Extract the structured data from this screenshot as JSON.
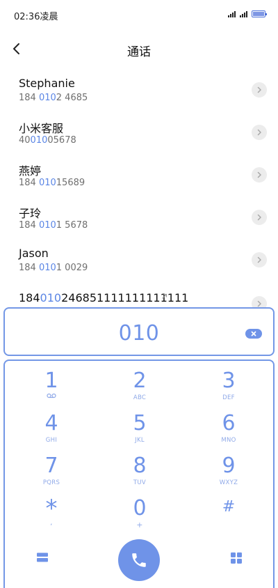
{
  "status_bar": {
    "time": "02:36凌晨"
  },
  "header": {
    "title": "通话"
  },
  "contacts": [
    {
      "name": "Stephanie",
      "number_pre": "184 ",
      "number_match": "010",
      "number_post": "2 4685"
    },
    {
      "name": "小米客服",
      "number_pre": "40",
      "number_match": "010",
      "number_post": "05678"
    },
    {
      "name": "燕婷",
      "number_pre": "184 ",
      "number_match": "010",
      "number_post": "15689"
    },
    {
      "name": "子玲",
      "number_pre": "184 ",
      "number_match": "010",
      "number_post": "1 5678"
    },
    {
      "name": "Jason",
      "number_pre": "184 ",
      "number_match": "010",
      "number_post": "1 0029"
    }
  ],
  "recent_number": {
    "pre": "184",
    "match": "010",
    "post": "246851111111111111"
  },
  "dialer": {
    "input_value": "010",
    "clear_label": "x"
  },
  "keypad": {
    "keys": [
      {
        "digit": "1",
        "letters": ""
      },
      {
        "digit": "2",
        "letters": "ABC"
      },
      {
        "digit": "3",
        "letters": "DEF"
      },
      {
        "digit": "4",
        "letters": "GHI"
      },
      {
        "digit": "5",
        "letters": "JKL"
      },
      {
        "digit": "6",
        "letters": "MNO"
      },
      {
        "digit": "7",
        "letters": "PQRS"
      },
      {
        "digit": "8",
        "letters": "TUV"
      },
      {
        "digit": "9",
        "letters": "WXYZ"
      },
      {
        "digit": "*",
        "letters": ","
      },
      {
        "digit": "0",
        "letters": "+"
      },
      {
        "digit": "#",
        "letters": ""
      }
    ]
  },
  "colors": {
    "accent": "#6f93e8",
    "match_highlight": "#5b86e5",
    "border": "#7397e6"
  }
}
